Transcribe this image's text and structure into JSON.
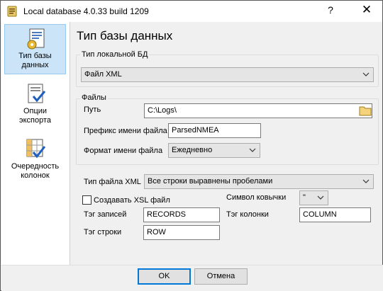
{
  "window": {
    "title": "Local database 4.0.33 build 1209",
    "help": "?",
    "close": "✕"
  },
  "sidebar": {
    "items": [
      {
        "label_line1": "Тип базы",
        "label_line2": "данных",
        "icon": "database-settings-icon"
      },
      {
        "label_line1": "Опции",
        "label_line2": "экспорта",
        "icon": "export-options-icon"
      },
      {
        "label_line1": "Очередность",
        "label_line2": "колонок",
        "icon": "column-order-icon"
      }
    ]
  },
  "main": {
    "title": "Тип базы данных",
    "local_db_group": {
      "label": "Тип локальной БД",
      "value": "Файл XML"
    },
    "files_group": {
      "label": "Файлы",
      "path_label": "Путь",
      "path_value": "C:\\Logs\\",
      "prefix_label": "Префикс имени файла",
      "prefix_value": "ParsedNMEA",
      "format_label": "Формат имени файла",
      "format_value": "Ежедневно"
    },
    "xml_type_label": "Тип файла XML",
    "xml_type_value": "Все строки выравнены пробелами",
    "create_xsl_label": "Создавать XSL файл",
    "create_xsl_checked": false,
    "quote_label": "Символ ковычки",
    "quote_value": "\"",
    "records_tag_label": "Тэг записей",
    "records_tag_value": "RECORDS",
    "column_tag_label": "Тэг колонки",
    "column_tag_value": "COLUMN",
    "row_tag_label": "Тэг строки",
    "row_tag_value": "ROW"
  },
  "footer": {
    "ok_label": "OK",
    "cancel_label": "Отмена"
  }
}
